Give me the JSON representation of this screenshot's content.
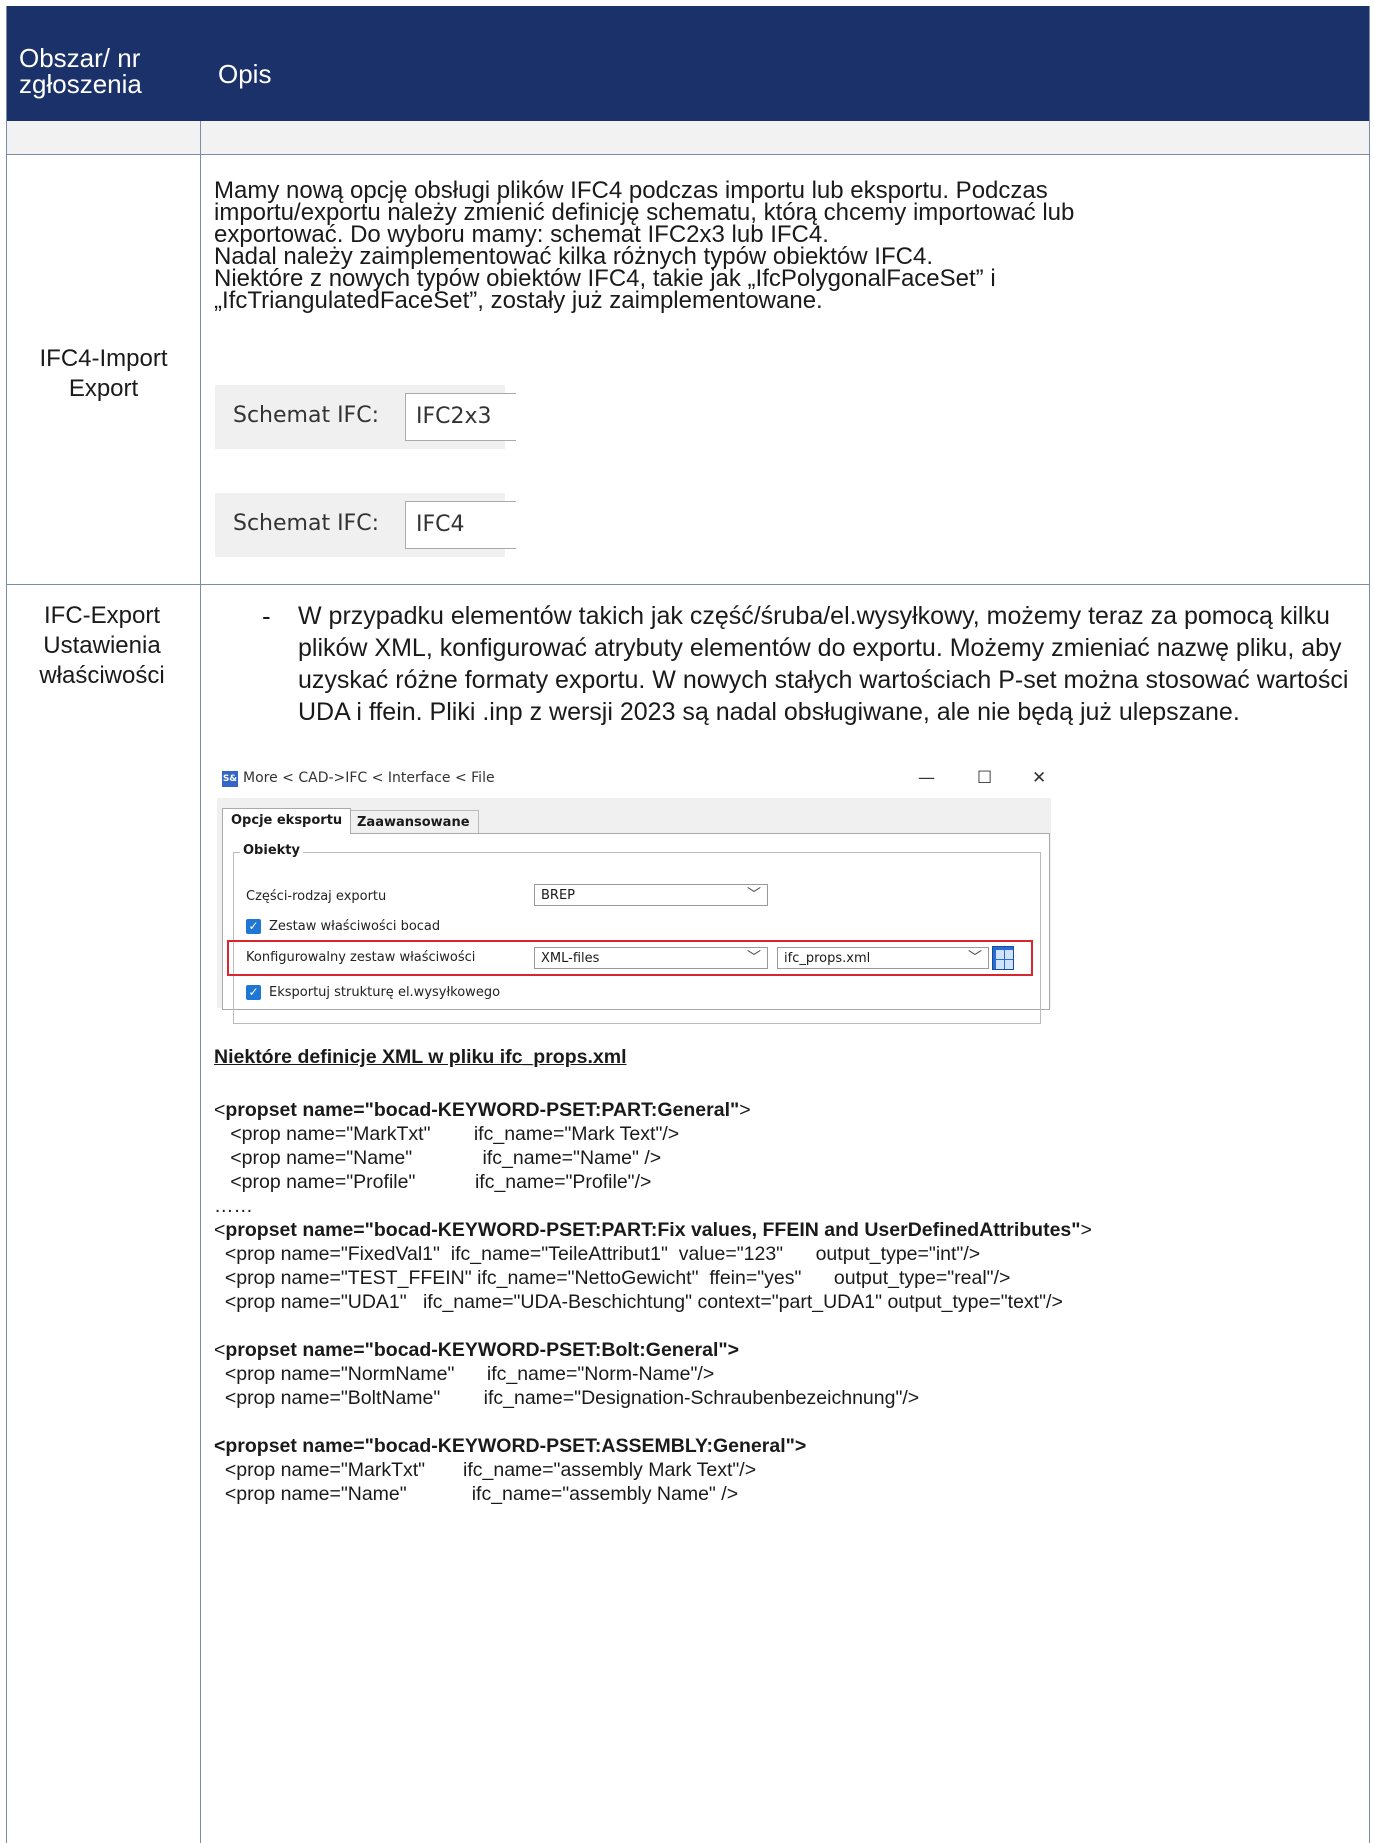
{
  "header": {
    "col1": "Obszar/ nr zgłoszenia",
    "col2": "Opis"
  },
  "rows": {
    "ifc4": {
      "label": "IFC4-Import Export",
      "paragraph": [
        "Mamy nową opcję obsługi plików IFC4 podczas importu lub eksportu. Podczas",
        "importu/exportu należy zmienić definicję schematu, którą chcemy importować lub",
        "exportować. Do wyboru mamy: schemat IFC2x3 lub IFC4.",
        "Nadal należy zaimplementować kilka różnych typów obiektów IFC4.",
        "Niektóre z nowych typów obiektów IFC4, takie jak „IfcPolygonalFaceSet” i",
        "„IfcTriangulatedFaceSet”, zostały już zaimplementowane."
      ],
      "schema_label": "Schemat IFC:",
      "schema_value_1": "IFC2x3",
      "schema_value_2": "IFC4"
    },
    "ifc_export": {
      "label": "IFC-Export Ustawienia właściwości",
      "bullet": "-",
      "bullet_text": "W przypadku elementów takich jak część/śruba/el.wysyłkowy, możemy teraz za pomocą kilku plików XML, konfigurować atrybuty elementów do exportu. Możemy zmieniać nazwę pliku, aby uzyskać różne formaty exportu. W nowych stałych wartościach P-set można stosować wartości UDA i ffein. Pliki .inp z wersji 2023 są nadal obsługiwane, ale nie będą już ulepszane."
    }
  },
  "dialog": {
    "app_icon": "S&",
    "title": "More < CAD->IFC < Interface < File",
    "minimize": "—",
    "maximize": "☐",
    "close": "✕",
    "tabs": [
      "Opcje eksportu",
      "Zaawansowane"
    ],
    "group_title": "Obiekty",
    "parts_export_label": "Części-rodzaj exportu",
    "parts_export_value": "BREP",
    "bocad_props_label": "Zestaw właściwości bocad",
    "config_props_label": "Konfigurowalny zestaw właściwości",
    "config_props_value": "XML-files",
    "config_file_value": "ifc_props.xml",
    "export_structure_label": "Eksportuj strukturę el.wysyłkowego",
    "checkbox_icon": "checkmark-icon",
    "dropdown_icon": "chevron-down-icon"
  },
  "xml_section": {
    "heading": "Niektóre definicje XML w pliku ifc_props.xml",
    "lines": [
      "",
      "",
      "   <prop name=\"MarkTxt\"        ifc_name=\"Mark Text\"/>",
      "   <prop name=\"Name\"             ifc_name=\"Name\" />",
      "   <prop name=\"Profile\"           ifc_name=\"Profile\"/>",
      "……",
      "",
      "  <prop name=\"FixedVal1\"  ifc_name=\"TeileAttribut1\"  value=\"123\"      output_type=\"int\"/>",
      "  <prop name=\"TEST_FFEIN\" ifc_name=\"NettoGewicht\"  ffein=\"yes\"      output_type=\"real\"/>",
      "  <prop name=\"UDA1\"   ifc_name=\"UDA-Beschichtung\" context=\"part_UDA1\" output_type=\"text\"/>",
      "",
      "",
      "  <prop name=\"NormName\"      ifc_name=\"Norm-Name\"/>",
      "  <prop name=\"BoltName\"        ifc_name=\"Designation-Schraubenbezeichnung\"/>",
      "",
      "",
      "  <prop name=\"MarkTxt\"       ifc_name=\"assembly Mark Text\"/>",
      "  <prop name=\"Name\"            ifc_name=\"assembly Name\" />"
    ],
    "propset_part_general_open": "<",
    "propset_part_general": "propset name=\"bocad-KEYWORD-PSET:PART:General\"",
    "propset_part_general_close": ">",
    "propset_part_fix_open": "<",
    "propset_part_fix": "propset name=\"bocad-KEYWORD-PSET:PART:Fix values, FFEIN and UserDefinedAttributes\"",
    "propset_part_fix_close": ">",
    "propset_bolt_open": "<",
    "propset_bolt": "propset name=\"bocad-KEYWORD-PSET:Bolt:General\">",
    "propset_assembly": "<propset name=\"bocad-KEYWORD-PSET:ASSEMBLY:General\">"
  }
}
